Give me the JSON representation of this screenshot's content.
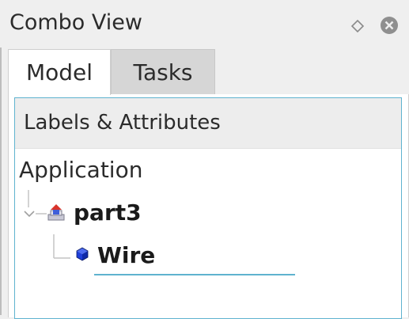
{
  "window": {
    "title": "Combo View"
  },
  "tabs": [
    {
      "label": "Model",
      "active": true
    },
    {
      "label": "Tasks",
      "active": false
    }
  ],
  "tree": {
    "header": "Labels & Attributes",
    "root_label": "Application",
    "items": [
      {
        "label": "part3",
        "icon": "part-container-icon",
        "expanded": true
      },
      {
        "label": "Wire",
        "icon": "blue-cube-icon",
        "editing": true
      }
    ]
  },
  "colors": {
    "accent": "#5fb3cf",
    "cube_blue": "#1f3fd9",
    "part_red": "#d9342b"
  }
}
